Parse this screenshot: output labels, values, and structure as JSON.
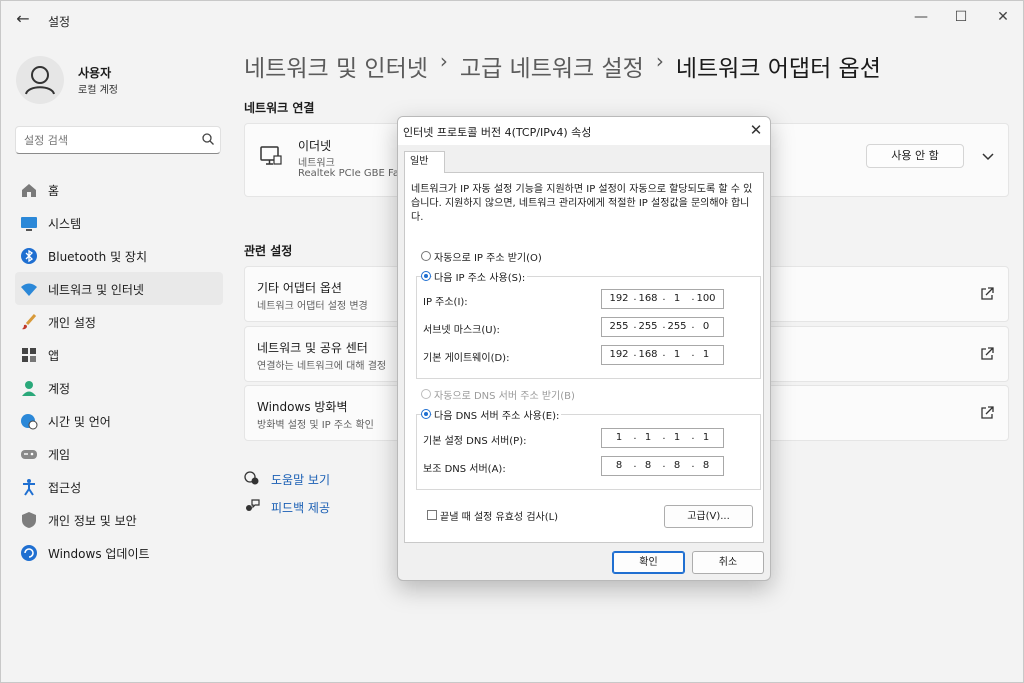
{
  "window": {
    "title": "설정"
  },
  "profile": {
    "name": "사용자",
    "sub": "로컬 계정"
  },
  "search": {
    "placeholder": "설정 검색"
  },
  "nav": [
    {
      "label": "홈",
      "icon": "home-icon"
    },
    {
      "label": "시스템",
      "icon": "system-icon"
    },
    {
      "label": "Bluetooth 및 장치",
      "icon": "bluetooth-icon"
    },
    {
      "label": "네트워크 및 인터넷",
      "icon": "wifi-icon",
      "active": true
    },
    {
      "label": "개인 설정",
      "icon": "brush-icon"
    },
    {
      "label": "앱",
      "icon": "apps-icon"
    },
    {
      "label": "계정",
      "icon": "account-icon"
    },
    {
      "label": "시간 및 언어",
      "icon": "globe-clock-icon"
    },
    {
      "label": "게임",
      "icon": "gamepad-icon"
    },
    {
      "label": "접근성",
      "icon": "accessibility-icon"
    },
    {
      "label": "개인 정보 및 보안",
      "icon": "shield-icon"
    },
    {
      "label": "Windows 업데이트",
      "icon": "update-icon"
    }
  ],
  "breadcrumb": {
    "part1": "네트워크 및 인터넷",
    "part2": "고급 네트워크 설정",
    "current": "네트워크 어댑터 옵션",
    "separator": "›"
  },
  "sections": {
    "connections": "네트워크 연결",
    "related": "관련 설정"
  },
  "adapter": {
    "name": "이더넷",
    "type": "네트워크",
    "device": "Realtek PCIe GBE Fam",
    "disable_button": "사용 안 함"
  },
  "related": [
    {
      "title": "기타 어댑터 옵션",
      "sub": "네트워크 어댑터 설정 변경"
    },
    {
      "title": "네트워크 및 공유 센터",
      "sub": "연결하는 네트워크에 대해 결정"
    },
    {
      "title": "Windows 방화벽",
      "sub": "방화벽 설정 및 IP 주소 확인"
    }
  ],
  "links": {
    "help": "도움말 보기",
    "feedback": "피드백 제공"
  },
  "dialog": {
    "title": "인터넷 프로토콜 버전 4(TCP/IPv4) 속성",
    "tab": "일반",
    "description": "네트워크가 IP 자동 설정 기능을 지원하면 IP 설정이 자동으로 할당되도록 할 수 있습니다. 지원하지 않으면, 네트워크 관리자에게 적절한 IP 설정값을 문의해야 합니다.",
    "ip_auto": "자동으로 IP 주소 받기(O)",
    "ip_manual": "다음 IP 주소 사용(S):",
    "ip_label": "IP 주소(I):",
    "subnet_label": "서브넷 마스크(U):",
    "gateway_label": "기본 게이트웨이(D):",
    "ip": [
      "192",
      "168",
      "1",
      "100"
    ],
    "subnet": [
      "255",
      "255",
      "255",
      "0"
    ],
    "gateway": [
      "192",
      "168",
      "1",
      "1"
    ],
    "dns_auto": "자동으로 DNS 서버 주소 받기(B)",
    "dns_manual": "다음 DNS 서버 주소 사용(E):",
    "dns1_label": "기본 설정 DNS 서버(P):",
    "dns2_label": "보조 DNS 서버(A):",
    "dns1": [
      "1",
      "1",
      "1",
      "1"
    ],
    "dns2": [
      "8",
      "8",
      "8",
      "8"
    ],
    "validate": "끝낼 때 설정 유효성 검사(L)",
    "advanced": "고급(V)...",
    "ok": "확인",
    "cancel": "취소"
  },
  "colors": {
    "accent": "#1f6fd1",
    "link": "#1a5fb4",
    "background": "#f3f3f3"
  }
}
